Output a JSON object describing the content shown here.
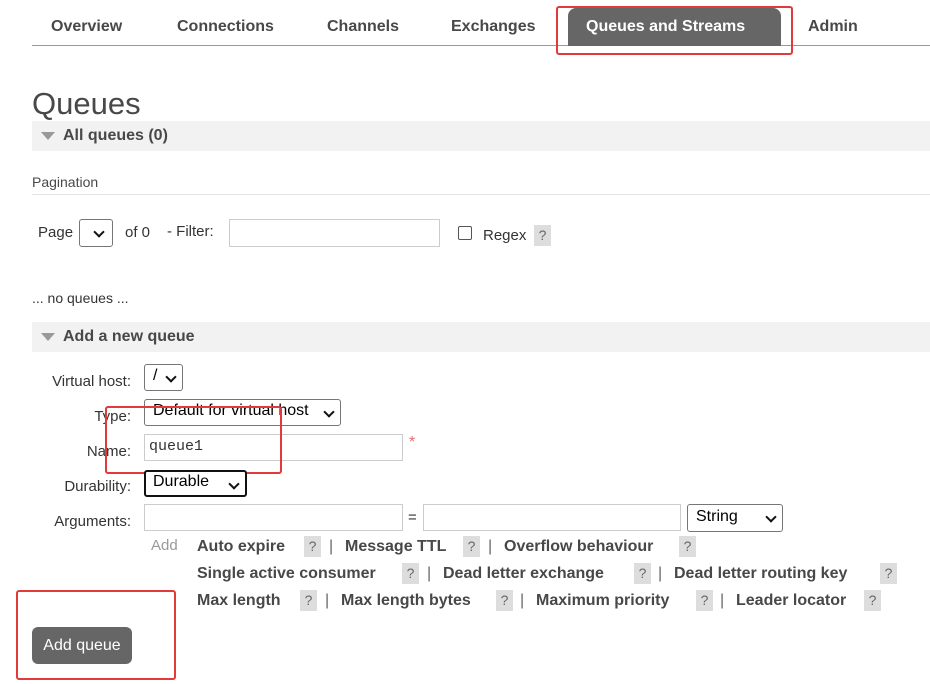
{
  "nav": {
    "tabs": [
      "Overview",
      "Connections",
      "Channels",
      "Exchanges",
      "Queues and Streams",
      "Admin"
    ],
    "selected": "Queues and Streams"
  },
  "page_title": "Queues",
  "all_queues": {
    "label": "All queues (0)"
  },
  "pagination": {
    "label": "Pagination",
    "page_label": "Page",
    "of_label": "of 0",
    "filter_label": "- Filter:",
    "filter_value": "",
    "regex_label": "Regex",
    "regex_checked": false,
    "help": "?"
  },
  "empty_message": "... no queues ...",
  "add_queue": {
    "header": "Add a new queue",
    "vhost_label": "Virtual host:",
    "vhost_value": "/",
    "type_label": "Type:",
    "type_value": "Default for virtual host",
    "name_label": "Name:",
    "name_value": "queue1",
    "required_mark": "*",
    "durability_label": "Durability:",
    "durability_value": "Durable",
    "arguments_label": "Arguments:",
    "equals": "=",
    "arg_type_value": "String",
    "add_label": "Add",
    "help": "?",
    "sep": "|",
    "arg_rows": [
      [
        "Auto expire",
        "Message TTL",
        "Overflow behaviour"
      ],
      [
        "Single active consumer",
        "Dead letter exchange",
        "Dead letter routing key"
      ],
      [
        "Max length",
        "Max length bytes",
        "Maximum priority",
        "Leader locator"
      ]
    ],
    "submit_label": "Add queue"
  },
  "colors": {
    "annotation_red": "#e23a3a",
    "selected_tab_bg": "#666666",
    "section_bg": "#f2f2f2",
    "button_bg": "#666666"
  }
}
